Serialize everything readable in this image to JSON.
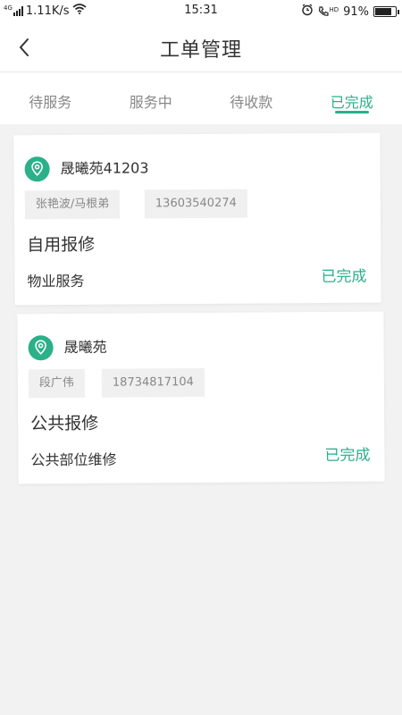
{
  "statusbar": {
    "signal_label": "4G",
    "speed": "1.11K/s",
    "time": "15:31",
    "hd_label": "HD",
    "battery_text": "91%",
    "battery_level": 0.91
  },
  "header": {
    "title": "工单管理"
  },
  "tabs": [
    {
      "label": "待服务"
    },
    {
      "label": "服务中"
    },
    {
      "label": "待收款"
    },
    {
      "label": "已完成"
    }
  ],
  "active_tab": 3,
  "accent_color": "#2bb08a",
  "orders": [
    {
      "community": "晟曦苑41203",
      "contact_name": "张艳波/马根弟",
      "phone": "13603540274",
      "repair_type": "自用报修",
      "category": "物业服务",
      "status": "已完成"
    },
    {
      "community": "晟曦苑",
      "contact_name": "段广伟",
      "phone": "18734817104",
      "repair_type": "公共报修",
      "category": "公共部位维修",
      "status": "已完成"
    }
  ]
}
